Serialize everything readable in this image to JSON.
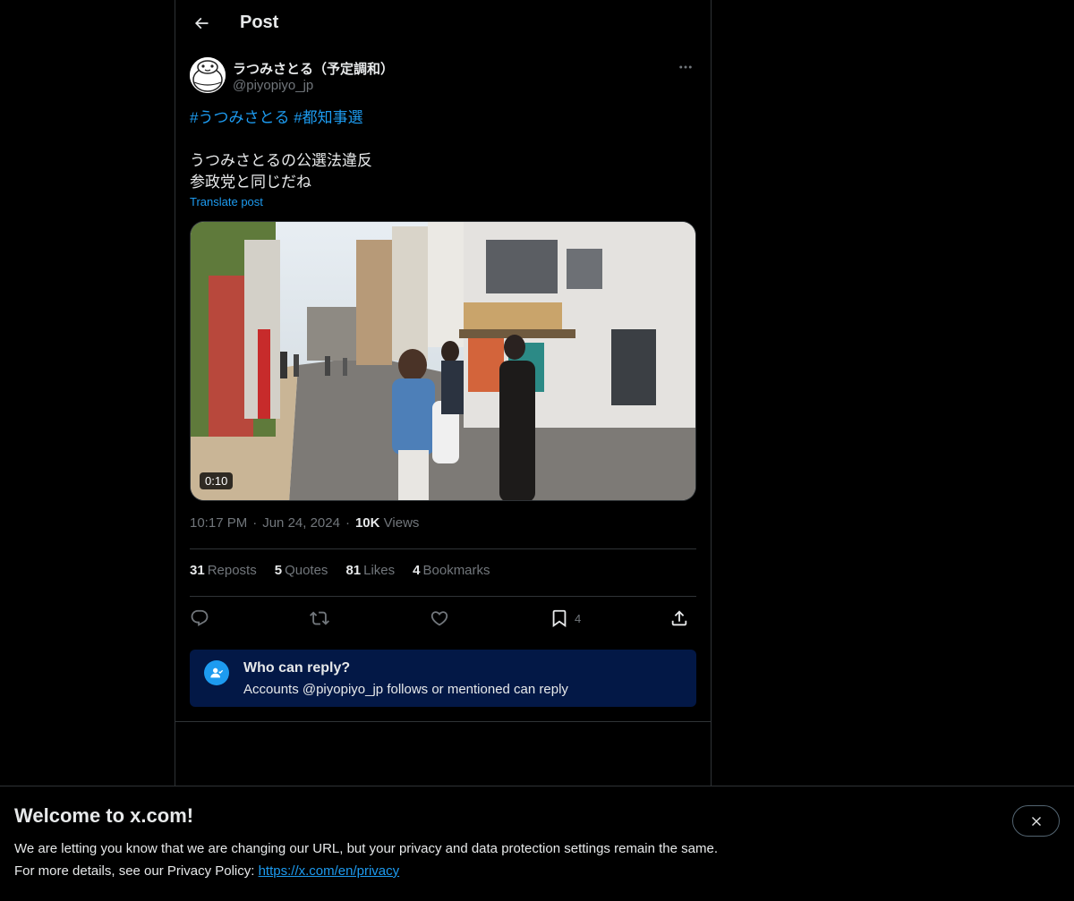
{
  "header": {
    "title": "Post"
  },
  "author": {
    "display_name": "ラつみさとる（予定調和）",
    "handle": "@piyopiyo_jp"
  },
  "tweet": {
    "hashtags": [
      "#うつみさとる",
      "#都知事選"
    ],
    "lines": [
      "うつみさとるの公選法違反",
      "参政党と同じだね"
    ],
    "translate_label": "Translate post"
  },
  "media": {
    "duration": "0:10"
  },
  "meta": {
    "time": "10:17 PM",
    "date": "Jun 24, 2024",
    "views_count": "10K",
    "views_label": "Views",
    "separator": "·"
  },
  "stats": {
    "reposts": {
      "count": "31",
      "label": "Reposts"
    },
    "quotes": {
      "count": "5",
      "label": "Quotes"
    },
    "likes": {
      "count": "81",
      "label": "Likes"
    },
    "bookmarks": {
      "count": "4",
      "label": "Bookmarks"
    }
  },
  "actions": {
    "bookmark_count": "4"
  },
  "reply_restriction": {
    "title": "Who can reply?",
    "subtitle": "Accounts @piyopiyo_jp follows or mentioned can reply"
  },
  "banner": {
    "title": "Welcome to x.com!",
    "line1": "We are letting you know that we are changing our URL, but your privacy and data protection settings remain the same.",
    "line2_prefix": "For more details, see our Privacy Policy: ",
    "link": "https://x.com/en/privacy"
  },
  "colors": {
    "accent": "#1d9bf0",
    "background": "#000000",
    "reply_box": "#031846",
    "muted": "#71767b"
  }
}
